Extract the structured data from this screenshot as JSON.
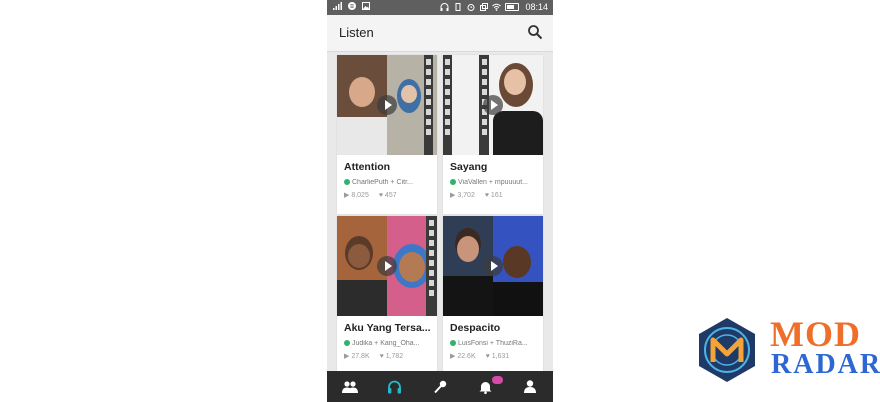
{
  "status_bar": {
    "time": "08:14"
  },
  "app_bar": {
    "title": "Listen"
  },
  "songs": [
    {
      "title": "Attention",
      "artists": "CharliePuth + Citr...",
      "plays": "8,025",
      "likes": "457"
    },
    {
      "title": "Sayang",
      "artists": "ViaVallen + mpuuuut...",
      "plays": "3,702",
      "likes": "161"
    },
    {
      "title": "Aku Yang Tersa...",
      "artists": "Judika + Kang_Oha...",
      "plays": "27.8K",
      "likes": "1,782"
    },
    {
      "title": "Despacito",
      "artists": "LuisFonsi + ThuziRa...",
      "plays": "22.6K",
      "likes": "1,631"
    }
  ],
  "bottom_nav": {
    "active": "headphones",
    "items": [
      "people-icon",
      "headphones-icon",
      "microphone-icon",
      "bell-icon",
      "profile-icon"
    ]
  },
  "watermark": {
    "line1": "MOD",
    "line2": "RADAR"
  },
  "colors": {
    "accent": "#2bb7c9",
    "verified": "#2db36b",
    "badge": "#d64aa8",
    "watermark_orange": "#ef6f2a",
    "watermark_blue": "#2c67d3"
  }
}
